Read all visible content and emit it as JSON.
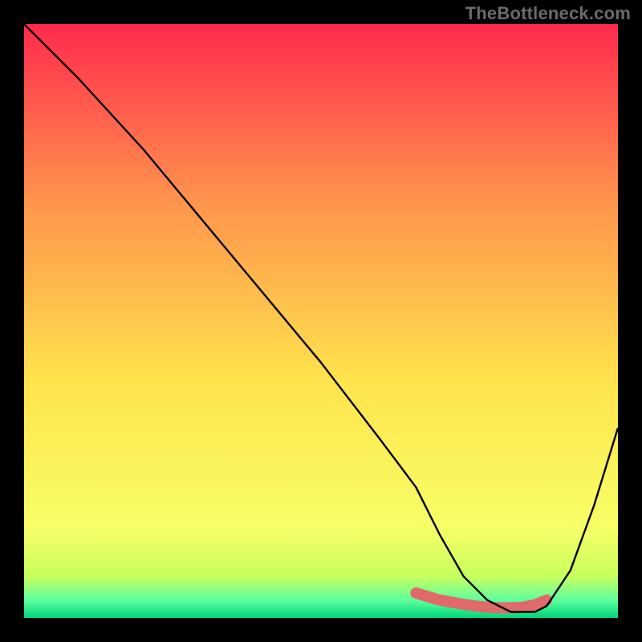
{
  "watermark": "TheBottleneck.com",
  "colors": {
    "frame_bg": "#000000",
    "grad_top": "#ff2a4d",
    "grad_mid_upper": "#ff944d",
    "grad_mid_lower": "#ffe34d",
    "grad_lower": "#f7ff66",
    "grad_green1": "#c7ff5e",
    "grad_green2": "#5eff9e",
    "grad_green3": "#00d67a",
    "curve": "#000000",
    "marker": "#e06a6a"
  },
  "chart_data": {
    "type": "line",
    "title": "",
    "xlabel": "",
    "ylabel": "",
    "xlim": [
      0,
      100
    ],
    "ylim": [
      0,
      100
    ],
    "series": [
      {
        "name": "bottleneck-curve",
        "x": [
          0,
          3,
          9,
          20,
          30,
          40,
          50,
          60,
          66,
          70,
          74,
          78,
          82,
          86,
          88,
          92,
          96,
          100
        ],
        "y": [
          100,
          97,
          91,
          79,
          67,
          55,
          43,
          30,
          22,
          14,
          7,
          3,
          1,
          1,
          2,
          8,
          19,
          32
        ]
      },
      {
        "name": "optimal-range-markers",
        "x": [
          66,
          70,
          74,
          76,
          78,
          80,
          82,
          84,
          86,
          88
        ],
        "y": [
          4.2,
          3.0,
          2.3,
          2.0,
          1.8,
          1.7,
          1.7,
          1.8,
          2.2,
          3.0
        ]
      }
    ],
    "annotations": []
  }
}
